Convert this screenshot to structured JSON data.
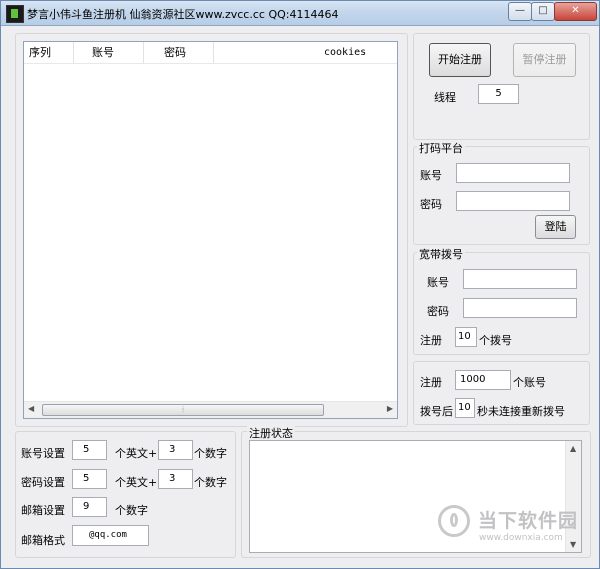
{
  "window": {
    "title": "梦言小伟斗鱼注册机  仙翁资源社区www.zvcc.cc  QQ:4114464",
    "controls": {
      "minimize": "—",
      "maximize": "□",
      "close": "✕"
    }
  },
  "list": {
    "columns": [
      "序列",
      "账号",
      "密码",
      "cookies"
    ],
    "rows": [],
    "scroll_thumb": "⦙"
  },
  "controls": {
    "start_button": "开始注册",
    "pause_button": "暂停注册",
    "thread_label": "线程",
    "thread_value": "5"
  },
  "captcha_group": {
    "title": "打码平台",
    "account_label": "账号",
    "account_value": "",
    "password_label": "密码",
    "password_value": "",
    "login_button": "登陆"
  },
  "broadband_group": {
    "title": "宽带拨号",
    "account_label": "账号",
    "account_value": "",
    "password_label": "密码",
    "password_value": "",
    "register_label": "注册",
    "register_value": "10",
    "register_suffix": "个拨号"
  },
  "register_group": {
    "register_label": "注册",
    "register_value": "1000",
    "register_suffix": "个账号",
    "dial_label": "拨号后",
    "dial_value": "10",
    "dial_suffix": "秒未连接重新拨号"
  },
  "settings": {
    "account_label": "账号设置",
    "account_letters": "5",
    "account_letters_suffix": "个英文+",
    "account_digits": "3",
    "account_digits_suffix": "个数字",
    "password_label": "密码设置",
    "password_letters": "5",
    "password_letters_suffix": "个英文+",
    "password_digits": "3",
    "password_digits_suffix": "个数字",
    "email_label": "邮箱设置",
    "email_digits": "9",
    "email_digits_suffix": "个数字",
    "email_format_label": "邮箱格式",
    "email_format_value": "@qq.com"
  },
  "status": {
    "title": "注册状态",
    "content": ""
  },
  "watermark": {
    "text": "当下软件园",
    "url": "www.downxia.com"
  }
}
